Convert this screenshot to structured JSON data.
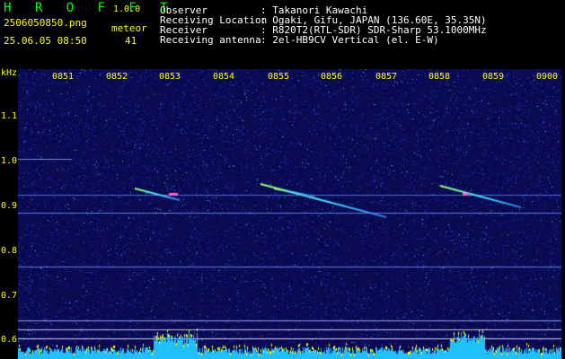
{
  "app": {
    "title": "H R O F F T",
    "version": "1.0.0"
  },
  "file": {
    "name": "2506050850.png",
    "datetime": "25.06.05 08:50"
  },
  "meteor": {
    "label": "meteor",
    "count": "41"
  },
  "info": [
    {
      "key": "Observer",
      "value": ": Takanori Kawachi"
    },
    {
      "key": "Receiving Location",
      "value": ": Ogaki, Gifu, JAPAN (136.60E, 35.35N)"
    },
    {
      "key": "Receiver",
      "value": ": R820T2(RTL-SDR) SDR-Sharp 53.1000MHz"
    },
    {
      "key": "Receiving antenna",
      "value": ": 2el-HB9CV Vertical (el. E-W)"
    }
  ],
  "axis": {
    "unit": "kHz",
    "y_ticks": [
      "1.1",
      "1.0",
      "0.9",
      "0.8",
      "0.7",
      "0.6"
    ],
    "x_ticks": [
      "0851",
      "0852",
      "0853",
      "0854",
      "0855",
      "0856",
      "0857",
      "0858",
      "0859",
      "0900"
    ]
  },
  "colors": {
    "background": "#000000",
    "text_header": "#ffffff",
    "yellow": "#ffff00",
    "green": "#00ff00",
    "noise": "#1a1a8c"
  }
}
